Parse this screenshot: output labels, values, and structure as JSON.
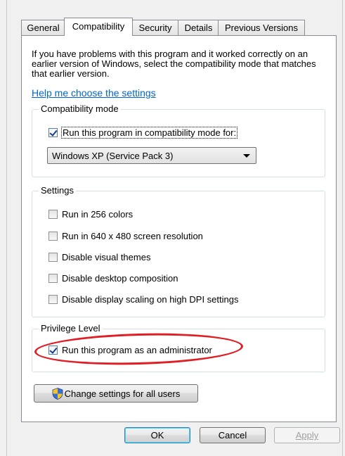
{
  "tabs": [
    {
      "label": "General"
    },
    {
      "label": "Compatibility"
    },
    {
      "label": "Security"
    },
    {
      "label": "Details"
    },
    {
      "label": "Previous Versions"
    }
  ],
  "intro_text": "If you have problems with this program and it worked correctly on an earlier version of Windows, select the compatibility mode that matches that earlier version.",
  "help_link": "Help me choose the settings",
  "compat_mode": {
    "group_label": "Compatibility mode",
    "checkbox_label": "Run this program in compatibility mode for:",
    "checked": true,
    "selected_os": "Windows XP (Service Pack 3)"
  },
  "settings": {
    "group_label": "Settings",
    "items": [
      {
        "label": "Run in 256 colors",
        "checked": false
      },
      {
        "label": "Run in 640 x 480 screen resolution",
        "checked": false
      },
      {
        "label": "Disable visual themes",
        "checked": false
      },
      {
        "label": "Disable desktop composition",
        "checked": false
      },
      {
        "label": "Disable display scaling on high DPI settings",
        "checked": false
      }
    ]
  },
  "privilege": {
    "group_label": "Privilege Level",
    "checkbox_label": "Run this program as an administrator",
    "checked": true
  },
  "change_settings_button": "Change settings for all users",
  "buttons": {
    "ok": "OK",
    "cancel": "Cancel",
    "apply": "Apply"
  },
  "annotation_color": "#e01e25"
}
